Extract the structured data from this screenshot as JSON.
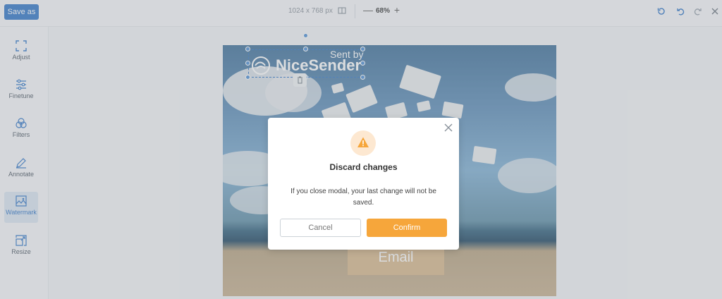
{
  "toolbar": {
    "save_label": "Save as",
    "dimensions": "1024 x 768 px",
    "zoom_out": "—",
    "zoom_value": "68%",
    "zoom_in": "+"
  },
  "sidebar": {
    "items": [
      {
        "label": "Adjust",
        "icon": "adjust-icon"
      },
      {
        "label": "Finetune",
        "icon": "finetune-icon"
      },
      {
        "label": "Filters",
        "icon": "filters-icon"
      },
      {
        "label": "Annotate",
        "icon": "annotate-icon"
      },
      {
        "label": "Watermark",
        "icon": "watermark-icon",
        "active": true
      },
      {
        "label": "Resize",
        "icon": "resize-icon"
      }
    ]
  },
  "canvas": {
    "watermark_line1": "Sent by",
    "watermark_line2": "NiceSender",
    "box_text": "Email"
  },
  "modal": {
    "title": "Discard changes",
    "message": "If you close modal, your last change will not be saved.",
    "cancel_label": "Cancel",
    "confirm_label": "Confirm"
  },
  "colors": {
    "primary": "#2f75c8",
    "confirm": "#f6a63b",
    "warning_bg": "#fde8d1"
  }
}
